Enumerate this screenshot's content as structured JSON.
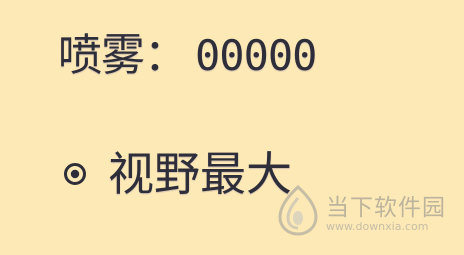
{
  "spray": {
    "label": "喷雾：",
    "value": "00000"
  },
  "view_option": {
    "label": "视野最大",
    "icon": "radio-selected-icon",
    "selected": true
  },
  "watermark": {
    "title": "当下软件园",
    "url": "www.downxia.com",
    "icon": "logo-icon"
  },
  "colors": {
    "background": "#fde9b5",
    "text": "#2e2e3a",
    "watermark": "#8a8a8a"
  }
}
